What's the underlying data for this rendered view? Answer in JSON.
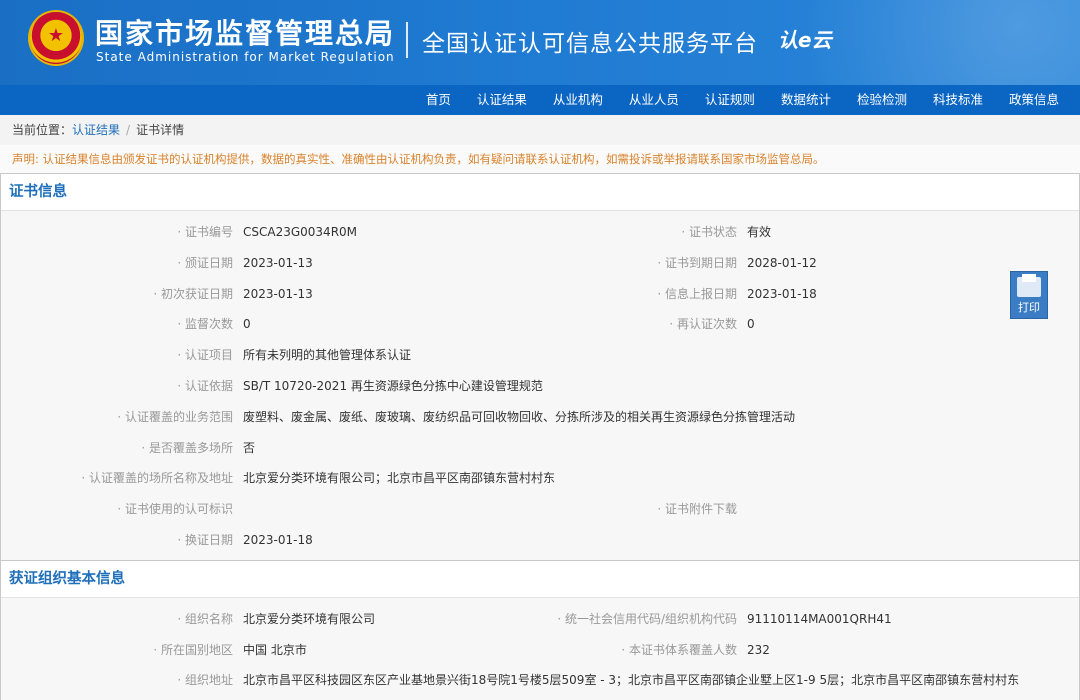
{
  "header": {
    "org_cn": "国家市场监督管理总局",
    "org_en": "State Administration  for  Market Regulation",
    "platform": "全国认证认可信息公共服务平台",
    "logo_text": "认e云"
  },
  "nav": [
    "首页",
    "认证结果",
    "从业机构",
    "从业人员",
    "认证规则",
    "数据统计",
    "检验检测",
    "科技标准",
    "政策信息"
  ],
  "breadcrumb": {
    "prefix": "当前位置：",
    "items": [
      "认证结果",
      "证书详情"
    ]
  },
  "notice": "声明: 认证结果信息由颁发证书的认证机构提供，数据的真实性、准确性由认证机构负责，如有疑问请联系认证机构，如需投诉或举报请联系国家市场监管总局。",
  "print_label": "打印",
  "cert_section": {
    "title": "证书信息",
    "rows": [
      {
        "l1": "证书编号",
        "v1": "CSCA23G0034R0M",
        "l2": "证书状态",
        "v2": "有效"
      },
      {
        "l1": "颁证日期",
        "v1": "2023-01-13",
        "l2": "证书到期日期",
        "v2": "2028-01-12"
      },
      {
        "l1": "初次获证日期",
        "v1": "2023-01-13",
        "l2": "信息上报日期",
        "v2": "2023-01-18"
      },
      {
        "l1": "监督次数",
        "v1": "0",
        "l2": "再认证次数",
        "v2": "0"
      },
      {
        "l1": "认证项目",
        "v1": "所有未列明的其他管理体系认证",
        "l2": "",
        "v2": ""
      },
      {
        "l1": "认证依据",
        "v1": "SB/T 10720-2021 再生资源绿色分拣中心建设管理规范",
        "l2": "",
        "v2": ""
      },
      {
        "l1": "认证覆盖的业务范围",
        "v1": "废塑料、废金属、废纸、废玻璃、废纺织品可回收物回收、分拣所涉及的相关再生资源绿色分拣管理活动",
        "l2": "",
        "v2": ""
      },
      {
        "l1": "是否覆盖多场所",
        "v1": "否",
        "l2": "",
        "v2": ""
      },
      {
        "l1": "认证覆盖的场所名称及地址",
        "v1": "北京爱分类环境有限公司；北京市昌平区南邵镇东营村村东",
        "l2": "",
        "v2": ""
      },
      {
        "l1": "证书使用的认可标识",
        "v1": "",
        "l2": "证书附件下载",
        "v2": ""
      },
      {
        "l1": "换证日期",
        "v1": "2023-01-18",
        "l2": "",
        "v2": ""
      }
    ]
  },
  "org_section": {
    "title": "获证组织基本信息",
    "rows": [
      {
        "l1": "组织名称",
        "v1": "北京爱分类环境有限公司",
        "l2": "统一社会信用代码/组织机构代码",
        "v2": "91110114MA001QRH41"
      },
      {
        "l1": "所在国别地区",
        "v1": "中国 北京市",
        "l2": "本证书体系覆盖人数",
        "v2": "232"
      },
      {
        "l1": "组织地址",
        "v1": "北京市昌平区科技园区东区产业基地景兴街18号院1号楼5层509室 - 3；北京市昌平区南邵镇企业墅上区1-9 5层；北京市昌平区南邵镇东营村村东",
        "l2": "",
        "v2": ""
      }
    ]
  }
}
